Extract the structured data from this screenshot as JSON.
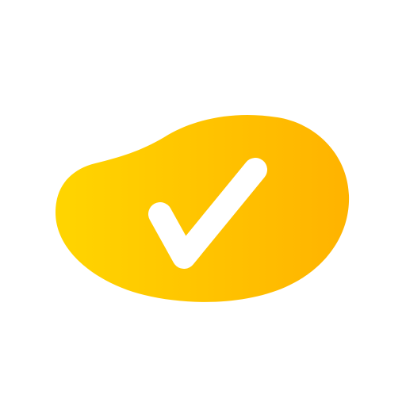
{
  "icon": {
    "name": "checkmark-blob-icon",
    "colors": {
      "gradient_start": "#FFD500",
      "gradient_end": "#FFB300",
      "check": "#FFFFFF",
      "background": "#FFFFFF"
    }
  }
}
